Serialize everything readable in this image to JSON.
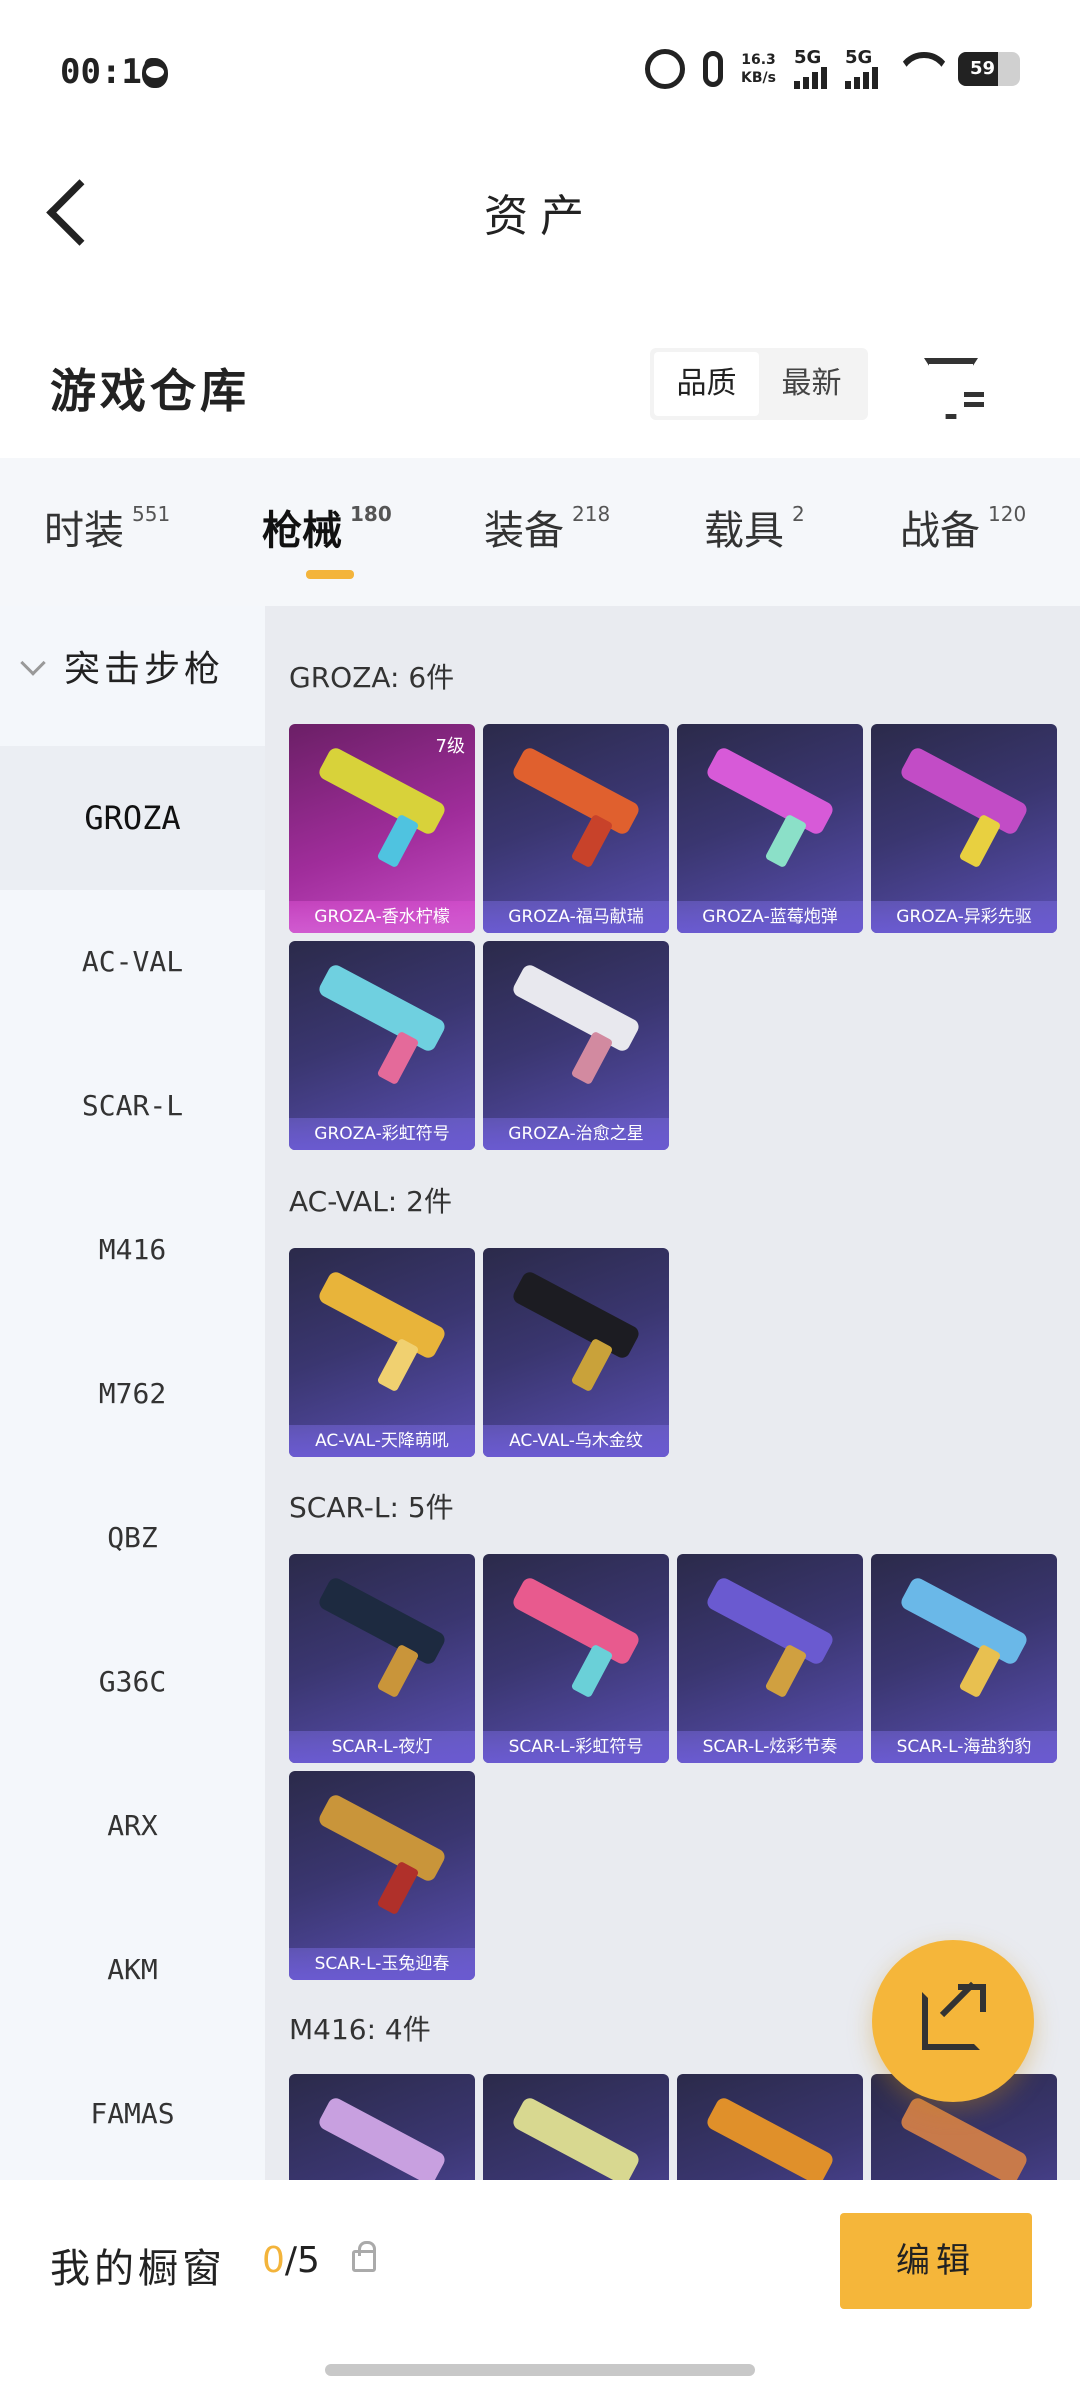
{
  "status_bar": {
    "time": "00:18",
    "net_speed": "16.3",
    "net_unit": "KB/s",
    "sig1": "5G",
    "sig2": "5G",
    "battery": "59"
  },
  "header": {
    "title": "资产"
  },
  "warehouse": {
    "title": "游戏仓库",
    "sort_quality": "品质",
    "sort_newest": "最新"
  },
  "tabs": [
    {
      "label": "时装",
      "count": "551"
    },
    {
      "label": "枪械",
      "count": "180"
    },
    {
      "label": "装备",
      "count": "218"
    },
    {
      "label": "载具",
      "count": "2"
    },
    {
      "label": "战备",
      "count": "120"
    }
  ],
  "sidebar": {
    "category": "突击步枪",
    "items": [
      "GROZA",
      "AC-VAL",
      "SCAR-L",
      "M416",
      "M762",
      "QBZ",
      "G36C",
      "ARX",
      "AKM",
      "FAMAS"
    ]
  },
  "groups": [
    {
      "label": "GROZA: 6件",
      "items": [
        {
          "name": "GROZA-香水柠檬",
          "badge": "7级"
        },
        {
          "name": "GROZA-福马献瑞"
        },
        {
          "name": "GROZA-蓝莓炮弹"
        },
        {
          "name": "GROZA-异彩先驱"
        },
        {
          "name": "GROZA-彩虹符号"
        },
        {
          "name": "GROZA-治愈之星"
        }
      ]
    },
    {
      "label": "AC-VAL: 2件",
      "items": [
        {
          "name": "AC-VAL-天降萌吼"
        },
        {
          "name": "AC-VAL-乌木金纹"
        }
      ]
    },
    {
      "label": "SCAR-L: 5件",
      "items": [
        {
          "name": "SCAR-L-夜灯"
        },
        {
          "name": "SCAR-L-彩虹符号"
        },
        {
          "name": "SCAR-L-炫彩节奏"
        },
        {
          "name": "SCAR-L-海盐豹豹"
        },
        {
          "name": "SCAR-L-玉兔迎春"
        }
      ]
    },
    {
      "label": "M416: 4件",
      "items": []
    }
  ],
  "bottom": {
    "label": "我的橱窗",
    "current": "0",
    "total": "/5",
    "edit": "编辑"
  },
  "colors": {
    "accent": "#f5b63a",
    "card_purple": "#5b50b5",
    "card_gold": "#c94fc9"
  }
}
